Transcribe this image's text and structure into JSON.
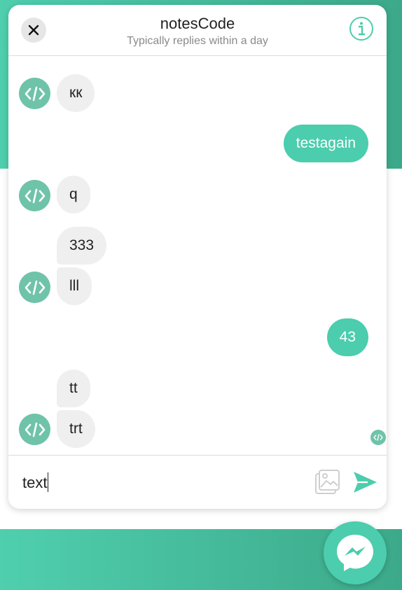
{
  "header": {
    "title": "notesCode",
    "subtitle": "Typically replies within a day"
  },
  "messages": [
    {
      "direction": "in",
      "text": "кк"
    },
    {
      "direction": "out",
      "text": "testagain"
    },
    {
      "direction": "in",
      "text": "q"
    },
    {
      "direction": "in",
      "text": "333"
    },
    {
      "direction": "in",
      "text": "lll"
    },
    {
      "direction": "out",
      "text": "43"
    },
    {
      "direction": "in",
      "text": "tt"
    },
    {
      "direction": "in",
      "text": "trt"
    }
  ],
  "composer": {
    "value": "text"
  },
  "icons": {
    "close": "close-icon",
    "info": "info-icon",
    "avatar": "code-icon",
    "image": "image-icon",
    "send": "send-icon",
    "messenger": "messenger-icon"
  },
  "colors": {
    "accent": "#4ccdad",
    "avatar": "#6fc3a8",
    "incoming_bubble": "#efefef"
  }
}
